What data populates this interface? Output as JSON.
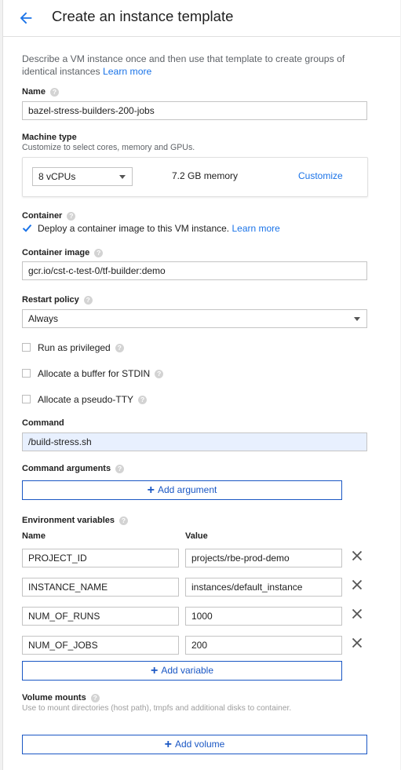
{
  "header": {
    "title": "Create an instance template"
  },
  "description": {
    "text": "Describe a VM instance once and then use that template to create groups of identical instances",
    "link": "Learn more"
  },
  "name": {
    "label": "Name",
    "value": "bazel-stress-builders-200-jobs"
  },
  "machine_type": {
    "label": "Machine type",
    "sub": "Customize to select cores, memory and GPUs.",
    "cpu_selected": "8 vCPUs",
    "memory": "7.2 GB memory",
    "customize": "Customize"
  },
  "container": {
    "label": "Container",
    "checkbox_label": "Deploy a container image to this VM instance.",
    "learn_more": "Learn more",
    "checked": true
  },
  "container_image": {
    "label": "Container image",
    "value": "gcr.io/cst-c-test-0/tf-builder:demo"
  },
  "restart_policy": {
    "label": "Restart policy",
    "value": "Always"
  },
  "options": {
    "privileged": "Run as privileged",
    "stdin": "Allocate a buffer for STDIN",
    "tty": "Allocate a pseudo-TTY"
  },
  "command": {
    "label": "Command",
    "value": "/build-stress.sh"
  },
  "command_args": {
    "label": "Command arguments",
    "add": "Add argument"
  },
  "env": {
    "label": "Environment variables",
    "name_header": "Name",
    "value_header": "Value",
    "rows": [
      {
        "name": "PROJECT_ID",
        "value": "projects/rbe-prod-demo"
      },
      {
        "name": "INSTANCE_NAME",
        "value": "instances/default_instance"
      },
      {
        "name": "NUM_OF_RUNS",
        "value": "1000"
      },
      {
        "name": "NUM_OF_JOBS",
        "value": "200"
      }
    ],
    "add": "Add variable"
  },
  "volumes": {
    "label": "Volume mounts",
    "sub": "Use to mount directories (host path), tmpfs and additional disks to container.",
    "add": "Add volume"
  },
  "help_glyph": "?",
  "colors": {
    "accent": "#1a73e8",
    "button_border": "#1a57c4",
    "checkbox": "#1a73e8",
    "command_bg": "#e8f0fe"
  }
}
